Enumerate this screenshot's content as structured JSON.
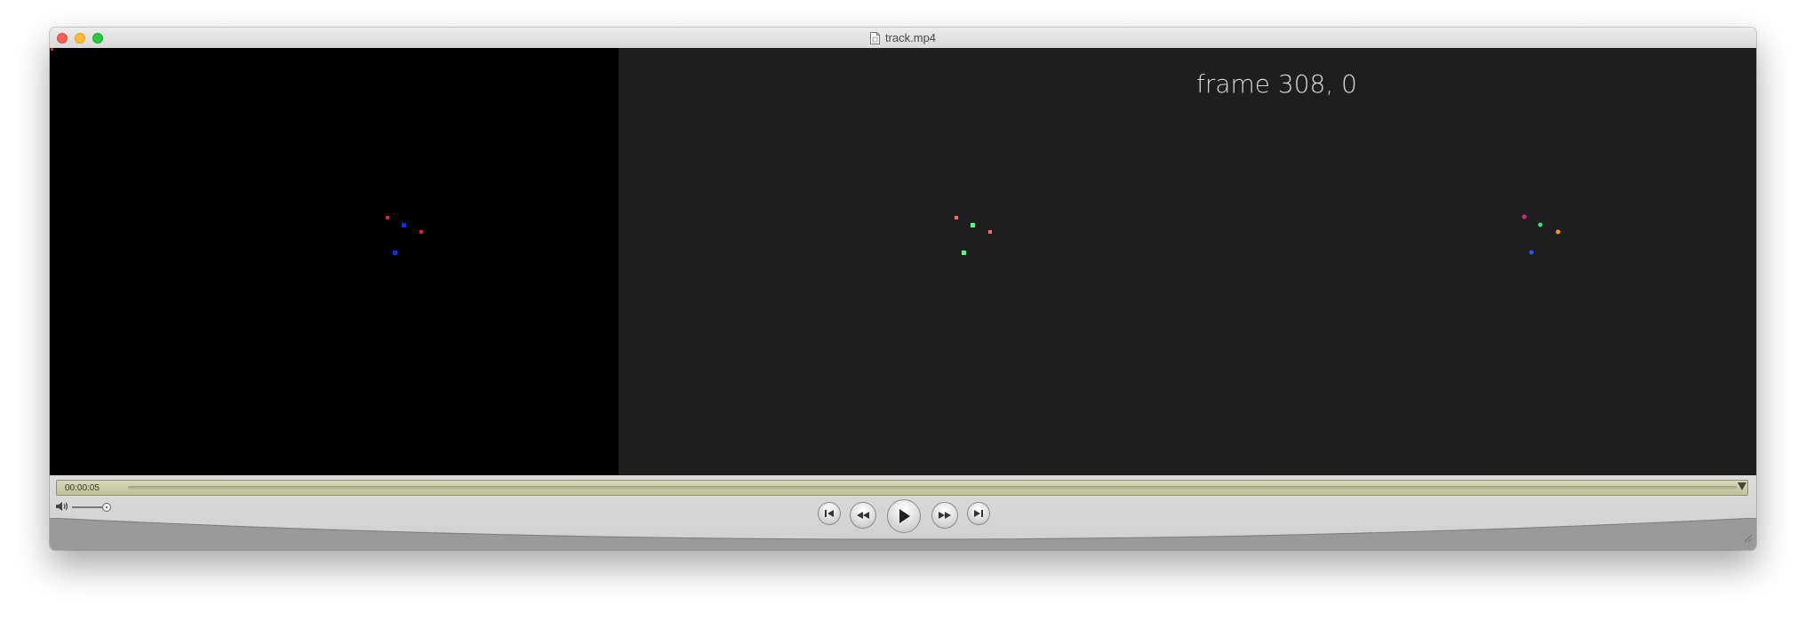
{
  "window": {
    "title": "track.mp4",
    "file_icon": "document-icon"
  },
  "video": {
    "overlay_text": "frame 308, 0",
    "left_pane_color": "#000000",
    "right_pane_color": "#1e1e1e",
    "markers": [
      {
        "pane": "left",
        "color": "#e02020"
      },
      {
        "pane": "left",
        "color": "#1030e0"
      },
      {
        "pane": "left",
        "color": "#e02020"
      },
      {
        "pane": "left",
        "color": "#1030e0"
      },
      {
        "pane": "middle",
        "color": "#ff6b6b"
      },
      {
        "pane": "middle",
        "color": "#5cf58a"
      },
      {
        "pane": "middle",
        "color": "#ff6b6b"
      },
      {
        "pane": "middle",
        "color": "#5cf58a"
      },
      {
        "pane": "right",
        "color": "#e0208a"
      },
      {
        "pane": "right",
        "color": "#39e36a"
      },
      {
        "pane": "right",
        "color": "#ff9a1a"
      },
      {
        "pane": "right",
        "color": "#1a5cff"
      }
    ]
  },
  "controls": {
    "timecode": "00:00:05",
    "volume_icon": "speaker-icon",
    "buttons": [
      {
        "name": "skip-to-start",
        "icon": "skip-back-icon"
      },
      {
        "name": "rewind",
        "icon": "rewind-icon"
      },
      {
        "name": "play",
        "icon": "play-icon"
      },
      {
        "name": "fast-forward",
        "icon": "fast-forward-icon"
      },
      {
        "name": "skip-to-end",
        "icon": "skip-forward-icon"
      }
    ]
  }
}
